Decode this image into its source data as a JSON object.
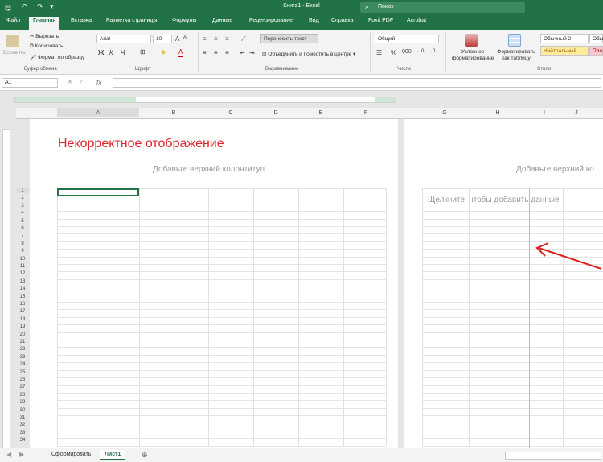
{
  "window": {
    "title": "Книга1 - Excel",
    "search_placeholder": "Поиск"
  },
  "tabs": [
    "Файл",
    "Главная",
    "Вставка",
    "Разметка страницы",
    "Формулы",
    "Данные",
    "Рецензирование",
    "Вид",
    "Справка",
    "Foxit PDF",
    "Acrobat"
  ],
  "ribbon": {
    "clipboard": {
      "paste": "Вставить",
      "cut": "Вырезать",
      "copy": "Копировать",
      "format_painter": "Формат по образцу",
      "group": "Буфер обмена"
    },
    "font": {
      "name": "Arial",
      "size": "10",
      "group": "Шрифт"
    },
    "alignment": {
      "wrap": "Переносить текст",
      "merge": "Объединить и поместить в центре",
      "group": "Выравнивание"
    },
    "number": {
      "format": "Общий",
      "group": "Число"
    },
    "styles": {
      "conditional": "Условное форматирование",
      "as_table": "Форматировать как таблицу",
      "normal2": "Обычный 2",
      "normal": "Обы",
      "neutral": "Нейтральный",
      "bad": "Пло",
      "group": "Стили"
    }
  },
  "formula_bar": {
    "cell_ref": "A1",
    "fx": "fx",
    "value": ""
  },
  "sheet": {
    "columns": [
      "A",
      "B",
      "C",
      "D",
      "E",
      "F",
      "G",
      "H",
      "I",
      "J"
    ],
    "rows": [
      "1",
      "2",
      "3",
      "4",
      "5",
      "6",
      "7",
      "8",
      "9",
      "10",
      "11",
      "12",
      "13",
      "14",
      "15",
      "16",
      "17",
      "18",
      "19",
      "20",
      "21",
      "22",
      "23",
      "24",
      "25",
      "26",
      "27",
      "28",
      "29",
      "30",
      "31",
      "32",
      "33",
      "34"
    ],
    "title": "Некорректное отображение",
    "header_placeholder": "Добавьте верхний колонтитул",
    "header_placeholder_2": "Добавьте верхний ко",
    "click_to_add": "Щелкните, чтобы добавить данные"
  },
  "sheet_tabs": [
    "Сформировать",
    "Лист1"
  ],
  "colors": {
    "accent": "#217346",
    "title_red": "#e0262c",
    "arrow": "#e02020"
  }
}
